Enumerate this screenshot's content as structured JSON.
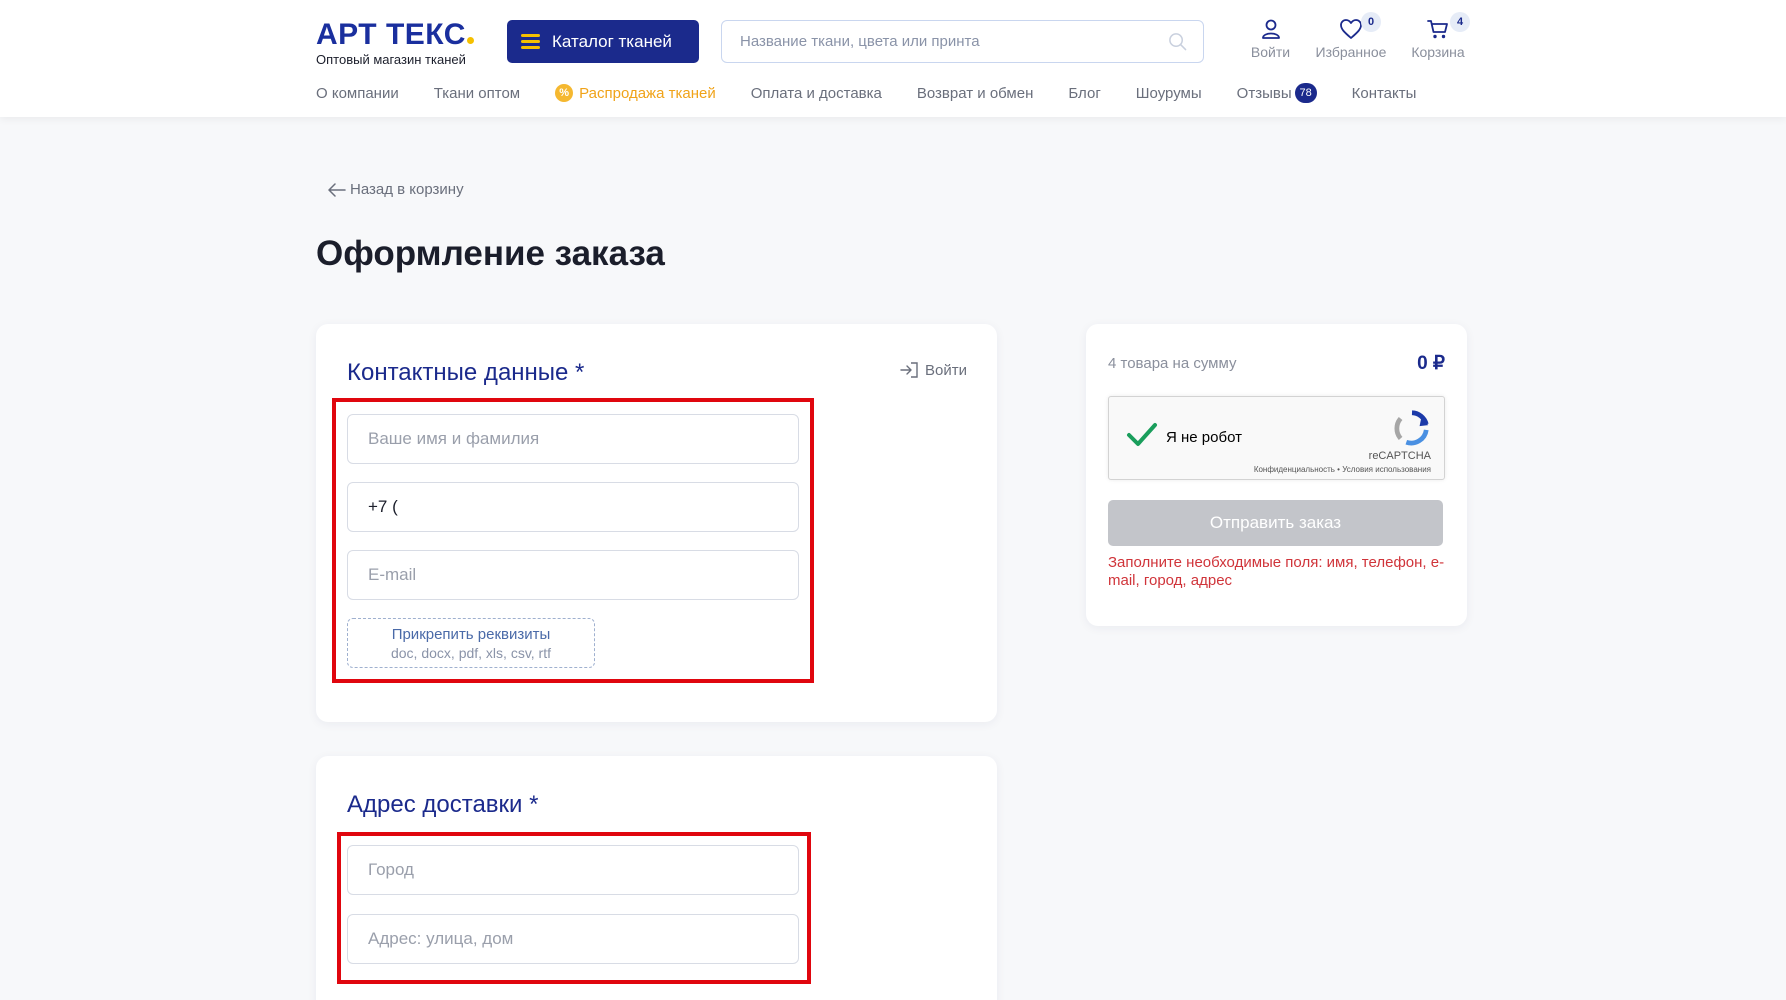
{
  "header": {
    "logo_main": "АРТ ТЕКС",
    "logo_sub": "Оптовый магазин тканей",
    "catalog_label": "Каталог тканей",
    "search_placeholder": "Название ткани, цвета или принта",
    "login_label": "Войти",
    "favorites_label": "Избранное",
    "favorites_count": "0",
    "cart_label": "Корзина",
    "cart_count": "4"
  },
  "nav": {
    "items": [
      {
        "label": "О компании"
      },
      {
        "label": "Ткани оптом"
      },
      {
        "label": "Распродажа тканей",
        "icon": "%"
      },
      {
        "label": "Оплата и доставка"
      },
      {
        "label": "Возврат и обмен"
      },
      {
        "label": "Блог"
      },
      {
        "label": "Шоурумы"
      },
      {
        "label": "Отзывы",
        "badge": "78"
      },
      {
        "label": "Контакты"
      }
    ]
  },
  "page": {
    "back_label": "Назад в корзину",
    "title": "Оформление заказа"
  },
  "contacts": {
    "title": "Контактные данные *",
    "login_label": "Войти",
    "name_placeholder": "Ваше имя и фамилия",
    "phone_value": "+7 (",
    "email_placeholder": "E-mail",
    "attach_label": "Прикрепить реквизиты",
    "attach_formats": "doc, docx, pdf, xls, csv, rtf"
  },
  "address": {
    "title": "Адрес доставки *",
    "city_placeholder": "Город",
    "street_placeholder": "Адрес: улица, дом"
  },
  "summary": {
    "items_text": "4 товара на сумму",
    "total": "0 ₽",
    "captcha_label": "Я не робот",
    "captcha_brand": "reCAPTCHA",
    "captcha_terms": "Конфиденциальность • Условия использования",
    "submit_label": "Отправить заказ",
    "error_text": "Заполните необходимые поля: имя, телефон, e-mail, город, адрес"
  },
  "colors": {
    "brand": "#1b2a8c",
    "accent": "#f5c000",
    "sale": "#f0a319",
    "error": "#d0343a",
    "highlight": "#e0060e"
  }
}
